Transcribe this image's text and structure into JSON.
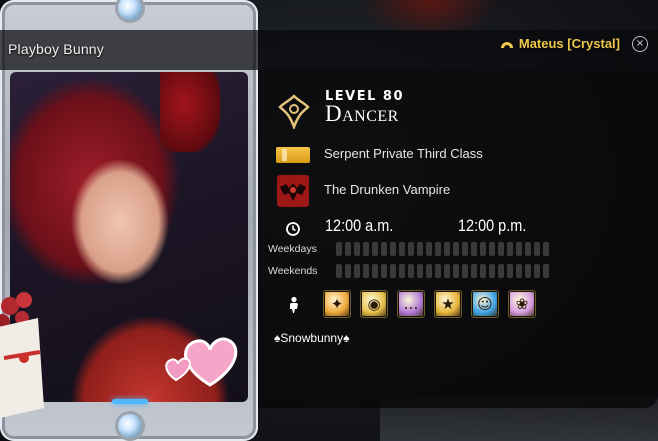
{
  "header": {
    "character_name": "Playboy Bunny",
    "server": "Mateus [Crystal]",
    "close_glyph": "×"
  },
  "profile": {
    "level_label": "LEVEL 80",
    "job": "Dancer",
    "grand_company_rank": "Serpent Private Third Class",
    "free_company": "The Drunken Vampire"
  },
  "schedule": {
    "time_am": "12:00 a.m.",
    "time_pm": "12:00 p.m.",
    "weekdays_label": "Weekdays",
    "weekends_label": "Weekends"
  },
  "playstyles": [
    {
      "icon": "battle-icon",
      "color": "#f0a93a"
    },
    {
      "icon": "gil-bag-icon",
      "color": "#e5c04a"
    },
    {
      "icon": "chat-bubble-icon",
      "color": "#b07bd8"
    },
    {
      "icon": "achievement-icon",
      "color": "#e7b63c"
    },
    {
      "icon": "smiley-icon",
      "color": "#3fa5e6"
    },
    {
      "icon": "roleplay-icon",
      "color": "#d49ce0"
    }
  ],
  "search_comment": "♠Snowbunny♠",
  "colors": {
    "server_gold": "#f0c84b",
    "accent_blue": "#4fb8ff",
    "fc_crest_red": "#9d1717"
  }
}
